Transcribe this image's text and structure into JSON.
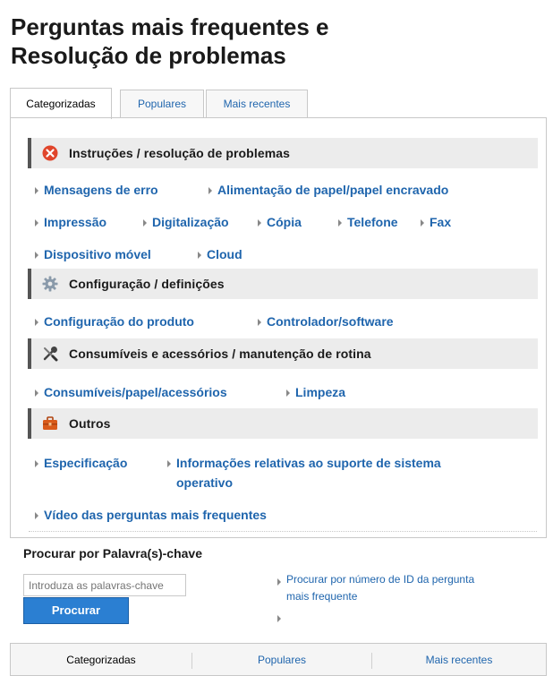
{
  "page": {
    "title_line1": "Perguntas mais frequentes e",
    "title_line2": "Resolução de problemas"
  },
  "tabs": [
    {
      "label": "Categorizadas",
      "active": true
    },
    {
      "label": "Populares",
      "active": false
    },
    {
      "label": "Mais recentes",
      "active": false
    }
  ],
  "sections": [
    {
      "icon": "error-x-icon",
      "label": "Instruções / resolução de problemas",
      "links": [
        "Mensagens de erro",
        "Alimentação de papel/papel encravado",
        "Impressão",
        "Digitalização",
        "Cópia",
        "Telefone",
        "Fax",
        "Dispositivo móvel",
        "Cloud"
      ]
    },
    {
      "icon": "gear-icon",
      "label": "Configuração / definições",
      "links": [
        "Configuração do produto",
        "Controlador/software"
      ]
    },
    {
      "icon": "tools-icon",
      "label": "Consumíveis e acessórios / manutenção de rotina",
      "links": [
        "Consumíveis/papel/acessórios",
        "Limpeza"
      ]
    },
    {
      "icon": "toolbox-icon",
      "label": "Outros",
      "links": [
        "Especificação",
        "Informações relativas ao suporte de sistema",
        "operativo",
        "Vídeo das perguntas mais frequentes"
      ]
    }
  ],
  "search": {
    "title": "Procurar por Palavra(s)-chave",
    "placeholder": "Introduza as palavras-chave",
    "button": "Procurar",
    "id_link_line1": "Procurar por número de ID da pergunta",
    "id_link_line2": "mais frequente"
  },
  "bottom_tabs": [
    "Categorizadas",
    "Populares",
    "Mais recentes"
  ],
  "colors": {
    "link": "#1f65ad",
    "button": "#2b7fd2",
    "section_bg": "#ececec",
    "error_icon": "#e0452b",
    "toolbox_icon": "#d95b1a"
  }
}
